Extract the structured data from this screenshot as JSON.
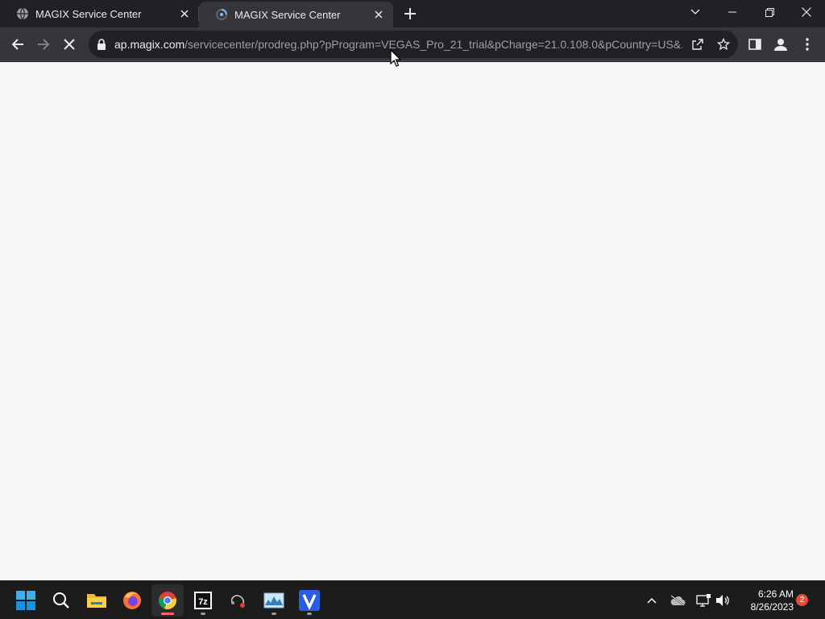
{
  "browser": {
    "tabs": [
      {
        "title": "MAGIX Service Center",
        "favicon": "globe-icon",
        "active": false
      },
      {
        "title": "MAGIX Service Center",
        "favicon": "loading-spinner-icon",
        "active": true
      }
    ],
    "url": {
      "host": "ap.magix.com",
      "path": "/servicecenter/prodreg.php?pProgram=VEGAS_Pro_21_trial&pCharge=21.0.108.0&pCountry=US&..."
    },
    "icons": {
      "back": "back-arrow-icon",
      "forward": "forward-arrow-icon",
      "stop": "stop-loading-icon",
      "share": "share-icon",
      "bookmark": "star-icon",
      "sidepanel": "side-panel-icon",
      "profile": "profile-icon",
      "menu": "kebab-menu-icon"
    }
  },
  "taskbar": {
    "apps": [
      "windows-start-icon",
      "search-icon",
      "file-explorer-icon",
      "firefox-icon",
      "chrome-icon",
      "7zip-icon",
      "app-icon",
      "monitor-app-icon",
      "vegas-icon"
    ],
    "clock": {
      "time": "6:26 AM",
      "date": "8/26/2023"
    },
    "notifications": "2"
  },
  "colors": {
    "page_background": "#f7f7f7",
    "chrome_dark": "#202124",
    "chrome_toolbar": "#35363a",
    "taskbar": "#1c1c1c"
  }
}
